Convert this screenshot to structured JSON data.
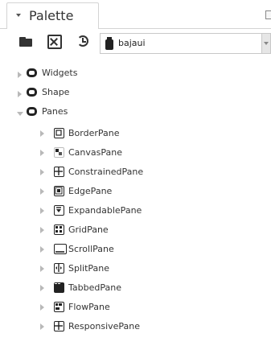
{
  "palette": {
    "tab_title": "Palette",
    "module_value": "bajaui"
  },
  "tree": {
    "root": [
      {
        "label": "Widgets",
        "expanded": false
      },
      {
        "label": "Shape",
        "expanded": false
      },
      {
        "label": "Panes",
        "expanded": true
      }
    ],
    "panes_children": [
      {
        "label": "BorderPane",
        "icon": "border-pane-icon"
      },
      {
        "label": "CanvasPane",
        "icon": "canvas-pane-icon"
      },
      {
        "label": "ConstrainedPane",
        "icon": "constrained-pane-icon"
      },
      {
        "label": "EdgePane",
        "icon": "edge-pane-icon"
      },
      {
        "label": "ExpandablePane",
        "icon": "expandable-pane-icon"
      },
      {
        "label": "GridPane",
        "icon": "grid-pane-icon"
      },
      {
        "label": "ScrollPane",
        "icon": "scroll-pane-icon"
      },
      {
        "label": "SplitPane",
        "icon": "split-pane-icon"
      },
      {
        "label": "TabbedPane",
        "icon": "tabbed-pane-icon"
      },
      {
        "label": "FlowPane",
        "icon": "flow-pane-icon"
      },
      {
        "label": "ResponsivePane",
        "icon": "responsive-pane-icon"
      }
    ]
  },
  "colors": {
    "icon_dark": "#222222",
    "twisty": "#b9b9b9",
    "border": "#d4d4d4"
  }
}
